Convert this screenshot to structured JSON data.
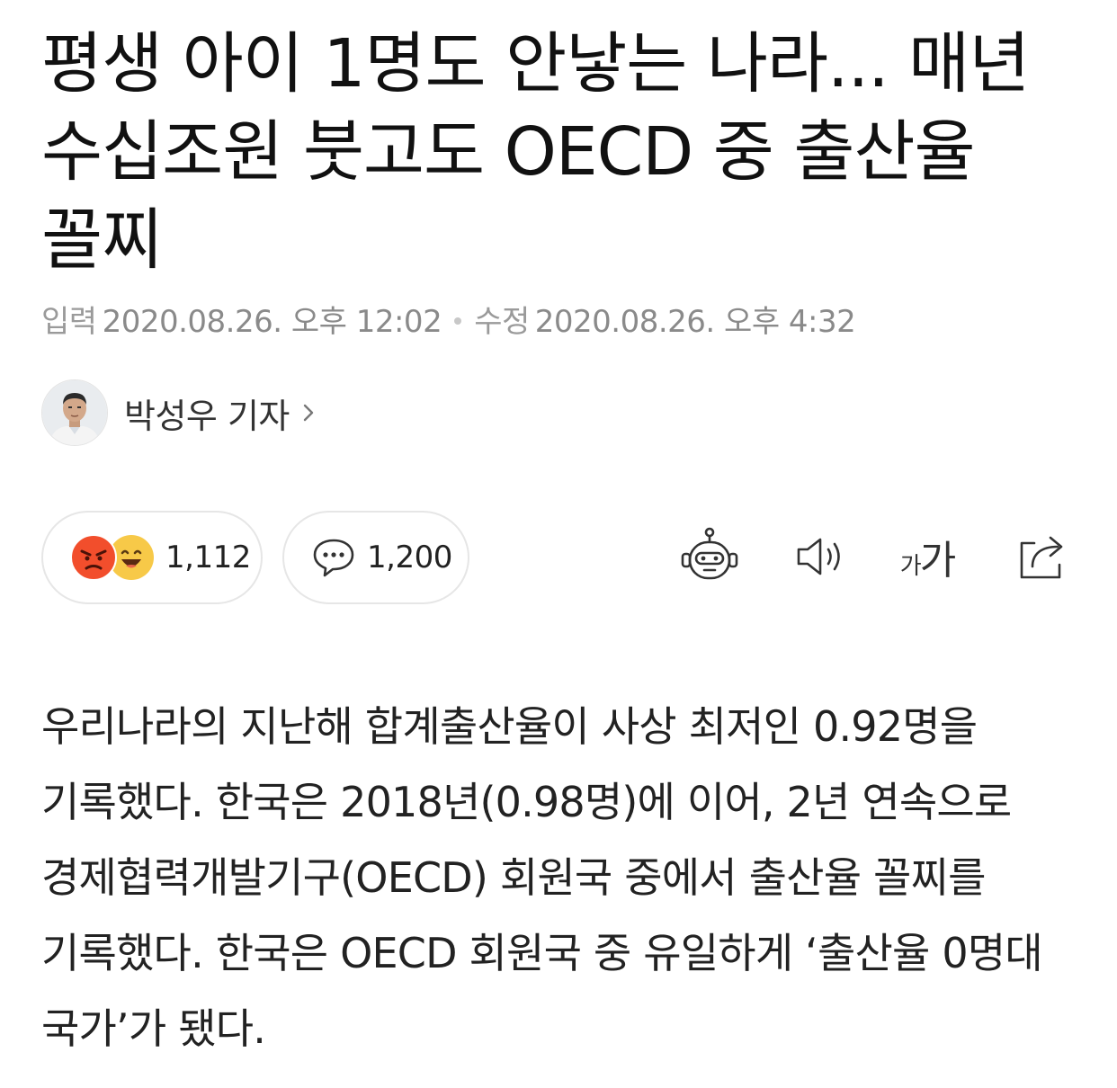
{
  "article": {
    "headline": "평생 아이 1명도 안낳는 나라... 매년 수십조원 붓고도 OECD 중 출산율 꼴찌",
    "input_label": "입력",
    "input_time": "2020.08.26. 오후 12:02",
    "modified_label": "수정",
    "modified_time": "2020.08.26. 오후 4:32",
    "author": "박성우 기자",
    "body": "우리나라의 지난해 합계출산율이 사상 최저인 0.92명을 기록했다. 한국은 2018년(0.98명)에 이어, 2년 연속으로 경제협력개발기구(OECD) 회원국 중에서 출산율 꼴찌를 기록했다. 한국은 OECD 회원국 중 유일하게 ‘출산율 0명대 국가’가 됐다."
  },
  "reactions": {
    "count": "1,112",
    "icons": [
      "angry-emoji-icon",
      "laughing-emoji-icon"
    ]
  },
  "comments": {
    "count": "1,200",
    "icon": "speech-bubble-icon"
  },
  "toolbar": {
    "icons": [
      "robot-summary-icon",
      "speaker-icon",
      "font-size-icon",
      "share-icon"
    ],
    "font_size_small": "가",
    "font_size_big": "가"
  },
  "colors": {
    "text": "#111111",
    "meta": "#8a8a8a",
    "border": "#e6e6e6",
    "angry": "#f24e2c",
    "laugh": "#f7c948"
  }
}
